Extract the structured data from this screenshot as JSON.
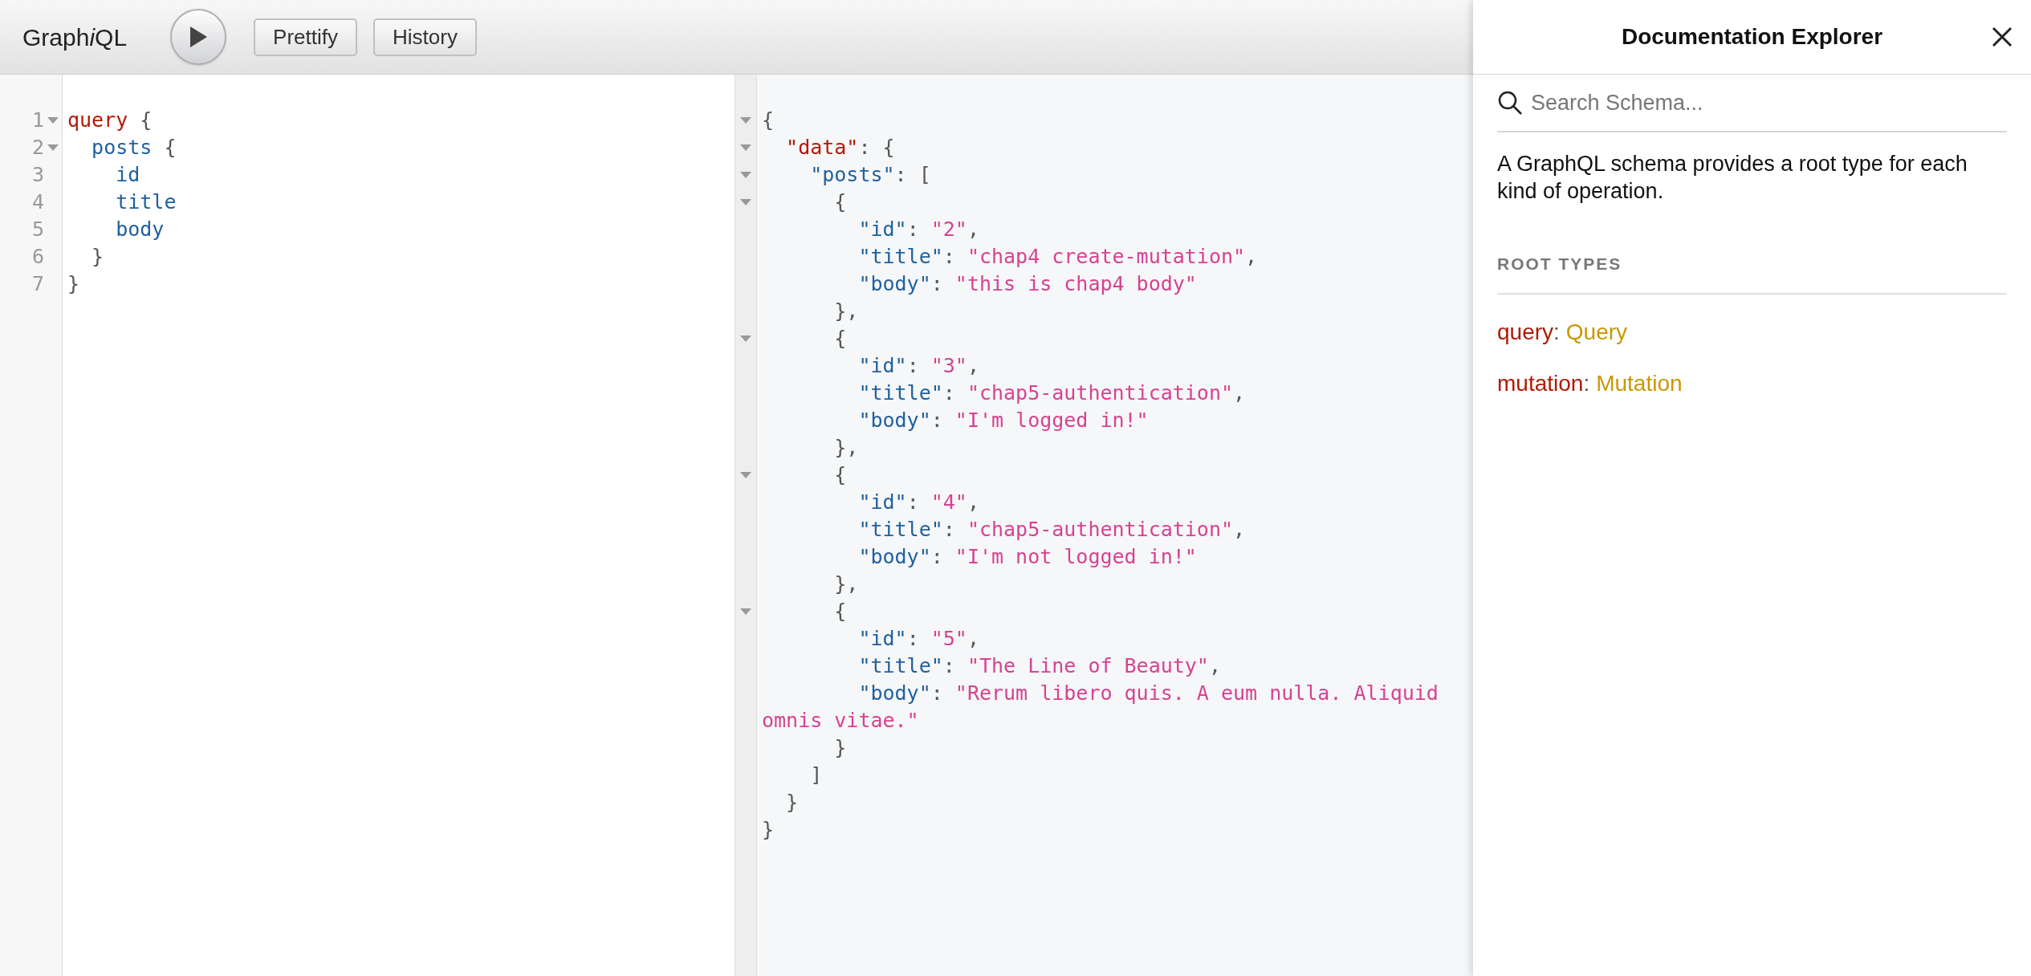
{
  "toolbar": {
    "logo": [
      {
        "text": "Graph",
        "italic": false
      },
      {
        "text": "i",
        "italic": true
      },
      {
        "text": "QL",
        "italic": false
      }
    ],
    "buttons": [
      "Prettify",
      "History"
    ]
  },
  "query_editor": {
    "lines": [
      {
        "number": "1",
        "foldable": true,
        "tokens": [
          {
            "kind": "keyword",
            "text": "query"
          },
          {
            "kind": "punct",
            "text": " {"
          }
        ],
        "children": [
          {
            "number": "2",
            "foldable": true,
            "tokens": [
              {
                "kind": "field",
                "text": "posts"
              },
              {
                "kind": "punct",
                "text": " {"
              }
            ],
            "children": [
              {
                "number": "3",
                "foldable": false,
                "tokens": [
                  {
                    "kind": "field",
                    "text": "id"
                  }
                ]
              },
              {
                "number": "4",
                "foldable": false,
                "tokens": [
                  {
                    "kind": "field",
                    "text": "title"
                  }
                ]
              },
              {
                "number": "5",
                "foldable": false,
                "tokens": [
                  {
                    "kind": "field",
                    "text": "body"
                  }
                ]
              }
            ]
          },
          {
            "number": "6",
            "foldable": false,
            "tokens": [
              {
                "kind": "punct",
                "text": "}"
              }
            ]
          }
        ]
      },
      {
        "number": "7",
        "foldable": false,
        "tokens": [
          {
            "kind": "punct",
            "text": "}"
          }
        ]
      }
    ]
  },
  "result_viewer": {
    "lines": [
      {
        "foldable": true,
        "tokens": [
          {
            "kind": "punct",
            "text": "{"
          }
        ],
        "children": [
          {
            "foldable": true,
            "tokens": [
              {
                "kind": "keyword",
                "text": "\"data\""
              },
              {
                "kind": "punct",
                "text": ": {"
              }
            ],
            "children": [
              {
                "foldable": true,
                "tokens": [
                  {
                    "kind": "field",
                    "text": "\"posts\""
                  },
                  {
                    "kind": "punct",
                    "text": ": ["
                  }
                ],
                "children": [
                  {
                    "foldable": true,
                    "tokens": [
                      {
                        "kind": "punct",
                        "text": "{"
                      }
                    ],
                    "children": [
                      {
                        "foldable": false,
                        "tokens": [
                          {
                            "kind": "field",
                            "text": "\"id\""
                          },
                          {
                            "kind": "punct",
                            "text": ": "
                          },
                          {
                            "kind": "string",
                            "text": "\"2\""
                          },
                          {
                            "kind": "punct",
                            "text": ","
                          }
                        ]
                      },
                      {
                        "foldable": false,
                        "tokens": [
                          {
                            "kind": "field",
                            "text": "\"title\""
                          },
                          {
                            "kind": "punct",
                            "text": ": "
                          },
                          {
                            "kind": "string",
                            "text": "\"chap4 create-mutation\""
                          },
                          {
                            "kind": "punct",
                            "text": ","
                          }
                        ]
                      },
                      {
                        "foldable": false,
                        "tokens": [
                          {
                            "kind": "field",
                            "text": "\"body\""
                          },
                          {
                            "kind": "punct",
                            "text": ": "
                          },
                          {
                            "kind": "string",
                            "text": "\"this is chap4 body\""
                          }
                        ]
                      }
                    ]
                  },
                  {
                    "foldable": false,
                    "tokens": [
                      {
                        "kind": "punct",
                        "text": "},"
                      }
                    ]
                  },
                  {
                    "foldable": true,
                    "tokens": [
                      {
                        "kind": "punct",
                        "text": "{"
                      }
                    ],
                    "children": [
                      {
                        "foldable": false,
                        "tokens": [
                          {
                            "kind": "field",
                            "text": "\"id\""
                          },
                          {
                            "kind": "punct",
                            "text": ": "
                          },
                          {
                            "kind": "string",
                            "text": "\"3\""
                          },
                          {
                            "kind": "punct",
                            "text": ","
                          }
                        ]
                      },
                      {
                        "foldable": false,
                        "tokens": [
                          {
                            "kind": "field",
                            "text": "\"title\""
                          },
                          {
                            "kind": "punct",
                            "text": ": "
                          },
                          {
                            "kind": "string",
                            "text": "\"chap5-authentication\""
                          },
                          {
                            "kind": "punct",
                            "text": ","
                          }
                        ]
                      },
                      {
                        "foldable": false,
                        "tokens": [
                          {
                            "kind": "field",
                            "text": "\"body\""
                          },
                          {
                            "kind": "punct",
                            "text": ": "
                          },
                          {
                            "kind": "string",
                            "text": "\"I'm logged in!\""
                          }
                        ]
                      }
                    ]
                  },
                  {
                    "foldable": false,
                    "tokens": [
                      {
                        "kind": "punct",
                        "text": "},"
                      }
                    ]
                  },
                  {
                    "foldable": true,
                    "tokens": [
                      {
                        "kind": "punct",
                        "text": "{"
                      }
                    ],
                    "children": [
                      {
                        "foldable": false,
                        "tokens": [
                          {
                            "kind": "field",
                            "text": "\"id\""
                          },
                          {
                            "kind": "punct",
                            "text": ": "
                          },
                          {
                            "kind": "string",
                            "text": "\"4\""
                          },
                          {
                            "kind": "punct",
                            "text": ","
                          }
                        ]
                      },
                      {
                        "foldable": false,
                        "tokens": [
                          {
                            "kind": "field",
                            "text": "\"title\""
                          },
                          {
                            "kind": "punct",
                            "text": ": "
                          },
                          {
                            "kind": "string",
                            "text": "\"chap5-authentication\""
                          },
                          {
                            "kind": "punct",
                            "text": ","
                          }
                        ]
                      },
                      {
                        "foldable": false,
                        "tokens": [
                          {
                            "kind": "field",
                            "text": "\"body\""
                          },
                          {
                            "kind": "punct",
                            "text": ": "
                          },
                          {
                            "kind": "string",
                            "text": "\"I'm not logged in!\""
                          }
                        ]
                      }
                    ]
                  },
                  {
                    "foldable": false,
                    "tokens": [
                      {
                        "kind": "punct",
                        "text": "},"
                      }
                    ]
                  },
                  {
                    "foldable": true,
                    "tokens": [
                      {
                        "kind": "punct",
                        "text": "{"
                      }
                    ],
                    "children": [
                      {
                        "foldable": false,
                        "tokens": [
                          {
                            "kind": "field",
                            "text": "\"id\""
                          },
                          {
                            "kind": "punct",
                            "text": ": "
                          },
                          {
                            "kind": "string",
                            "text": "\"5\""
                          },
                          {
                            "kind": "punct",
                            "text": ","
                          }
                        ]
                      },
                      {
                        "foldable": false,
                        "tokens": [
                          {
                            "kind": "field",
                            "text": "\"title\""
                          },
                          {
                            "kind": "punct",
                            "text": ": "
                          },
                          {
                            "kind": "string",
                            "text": "\"The Line of Beauty\""
                          },
                          {
                            "kind": "punct",
                            "text": ","
                          }
                        ]
                      },
                      {
                        "foldable": false,
                        "tokens": [
                          {
                            "kind": "field",
                            "text": "\"body\""
                          },
                          {
                            "kind": "punct",
                            "text": ": "
                          },
                          {
                            "kind": "string",
                            "text": "\"Rerum libero quis. A eum nulla. Aliquid omnis vitae.\""
                          }
                        ]
                      }
                    ]
                  },
                  {
                    "foldable": false,
                    "tokens": [
                      {
                        "kind": "punct",
                        "text": "}"
                      }
                    ]
                  }
                ]
              },
              {
                "foldable": false,
                "tokens": [
                  {
                    "kind": "punct",
                    "text": "]"
                  }
                ]
              }
            ]
          },
          {
            "foldable": false,
            "tokens": [
              {
                "kind": "punct",
                "text": "}"
              }
            ]
          }
        ]
      },
      {
        "foldable": false,
        "tokens": [
          {
            "kind": "punct",
            "text": "}"
          }
        ]
      }
    ]
  },
  "doc_explorer": {
    "title": "Documentation Explorer",
    "search": {
      "placeholder": "Search Schema..."
    },
    "description": "A GraphQL schema provides a root type for each kind of operation.",
    "section_title": "ROOT TYPES",
    "root_types": [
      {
        "field": "query",
        "separator": ":",
        "type": "Query"
      },
      {
        "field": "mutation",
        "separator": ":",
        "type": "Mutation"
      }
    ]
  }
}
